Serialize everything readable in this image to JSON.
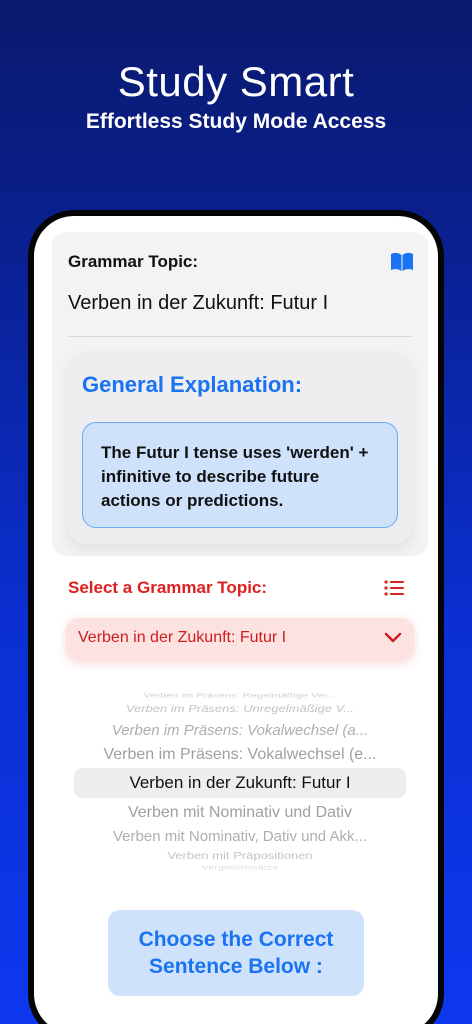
{
  "hero": {
    "title": "Study Smart",
    "subtitle": "Effortless Study Mode Access"
  },
  "topic": {
    "label": "Grammar Topic:",
    "value": "Verben in der Zukunft: Futur I",
    "icon": "book-icon"
  },
  "explanation": {
    "title": "General Explanation:",
    "text": "The Futur I tense uses 'werden' + infinitive to describe future actions or predictions."
  },
  "selector": {
    "label": "Select a Grammar Topic:",
    "icon": "list-icon",
    "selected": "Verben in der Zukunft: Futur I",
    "options": [
      "Verben im Präsens: Regelmäßige Ver...",
      "Verben im Präsens: Unregelmäßige V...",
      "Verben im Präsens: Vokalwechsel (a...",
      "Verben im Präsens: Vokalwechsel (e...",
      "Verben in der Zukunft: Futur I",
      "Verben mit Nominativ und Dativ",
      "Verben mit Nominativ, Dativ und Akk...",
      "Verben mit Präpositionen",
      "Vergleichssätze"
    ]
  },
  "cta": {
    "line1": "Choose the Correct",
    "line2": "Sentence Below :"
  },
  "colors": {
    "accent_blue": "#1a73f2",
    "accent_red": "#e02020",
    "bg_top": "#0a1a6e",
    "bg_bottom": "#0d38ee"
  }
}
